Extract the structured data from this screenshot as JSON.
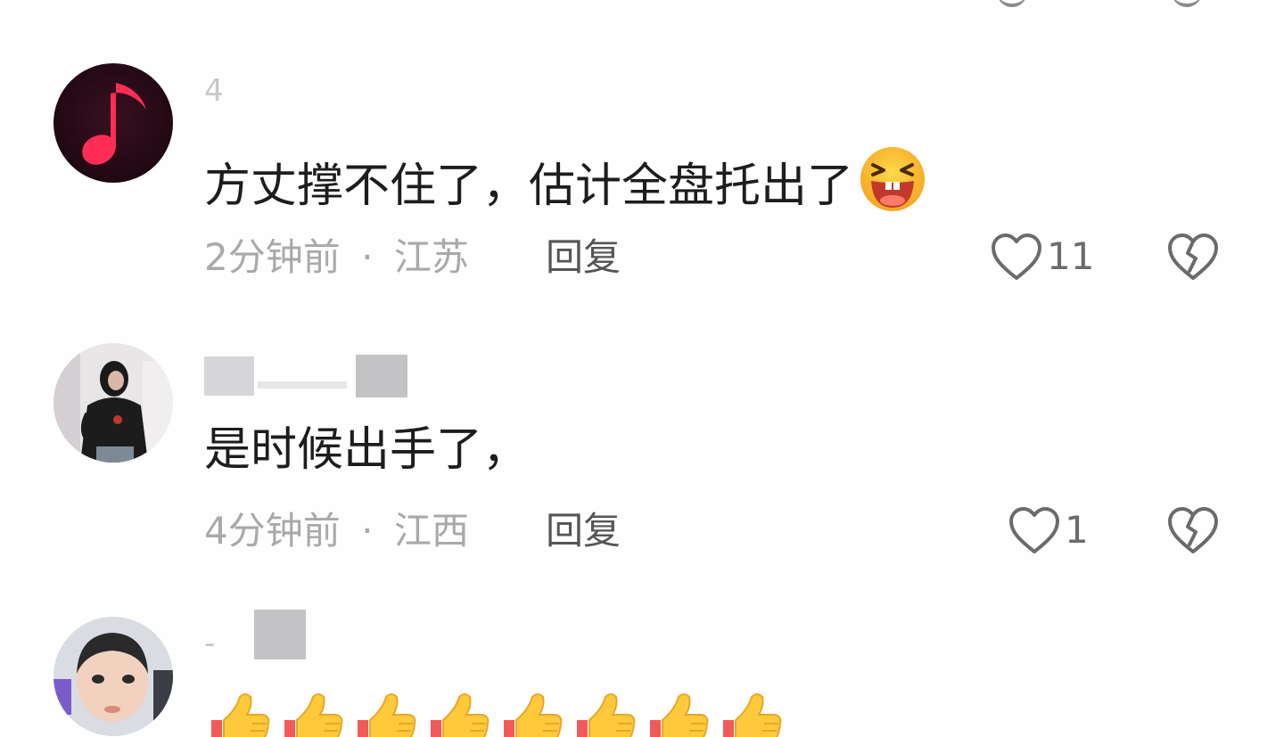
{
  "comments": [
    {
      "username_fragment": "4",
      "text": "方丈撑不住了，估计全盘托出了",
      "emoji": "laughing-face",
      "time": "2分钟前",
      "separator": "·",
      "location": "江苏",
      "reply_label": "回复",
      "like_count": "11",
      "avatar": "music-note-avatar"
    },
    {
      "username_fragment": "",
      "text": "是时候出手了，",
      "time": "4分钟前",
      "separator": "·",
      "location": "江西",
      "reply_label": "回复",
      "like_count": "1",
      "avatar": "woman-photo-avatar"
    },
    {
      "username_fragment": "-",
      "text": "",
      "emoji_row": [
        "thumbs-up",
        "thumbs-up",
        "thumbs-up",
        "thumbs-up",
        "thumbs-up",
        "thumbs-up",
        "thumbs-up",
        "thumbs-up"
      ],
      "avatar": "boy-photo-avatar"
    }
  ],
  "icons": {
    "like": "heart-outline-icon",
    "dislike": "broken-heart-icon"
  },
  "colors": {
    "text_primary": "#1d1d1d",
    "text_meta": "#a9a9a9",
    "reply": "#555555",
    "icon": "#6b6b6b"
  }
}
